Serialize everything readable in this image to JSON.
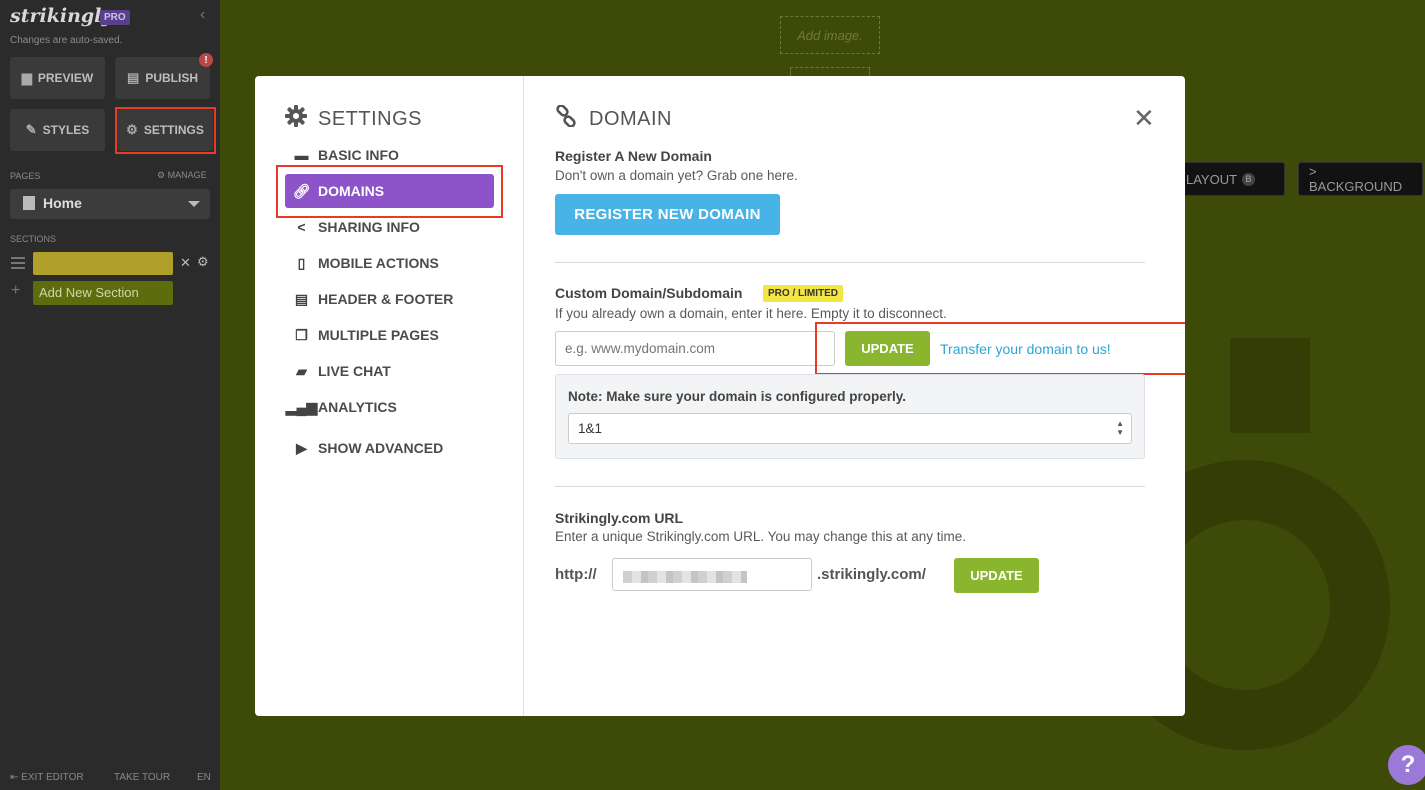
{
  "sidebar": {
    "brand": "strikingly",
    "pro_badge": "PRO",
    "autosave": "Changes are auto-saved.",
    "buttons": {
      "preview": "PREVIEW",
      "publish": "PUBLISH",
      "publish_alert": "!",
      "styles": "STYLES",
      "settings": "SETTINGS"
    },
    "pages_label": "PAGES",
    "manage_label": "MANAGE",
    "current_page": "Home",
    "sections_label": "SECTIONS",
    "add_section": "Add New Section",
    "footer": {
      "exit": "EXIT EDITOR",
      "tour": "TAKE TOUR",
      "lang": "EN"
    }
  },
  "canvas": {
    "add_image": "Add image.",
    "layout_btn": "LAYOUT",
    "layout_badge": "B",
    "background_btn": "> BACKGROUND",
    "help": "?"
  },
  "modal": {
    "nav_title": "SETTINGS",
    "nav_items": [
      {
        "label": "BASIC INFO",
        "icon": "briefcase-icon"
      },
      {
        "label": "DOMAINS",
        "icon": "link-icon"
      },
      {
        "label": "SHARING INFO",
        "icon": "share-icon"
      },
      {
        "label": "MOBILE ACTIONS",
        "icon": "mobile-icon"
      },
      {
        "label": "HEADER & FOOTER",
        "icon": "header-footer-icon"
      },
      {
        "label": "MULTIPLE PAGES",
        "icon": "pages-icon"
      },
      {
        "label": "LIVE CHAT",
        "icon": "chat-icon"
      },
      {
        "label": "ANALYTICS",
        "icon": "analytics-icon"
      },
      {
        "label": "SHOW ADVANCED",
        "icon": "advanced-icon"
      }
    ],
    "active_nav": "DOMAINS",
    "title": "DOMAIN",
    "register": {
      "heading": "Register A New Domain",
      "text": "Don't own a domain yet? Grab one here.",
      "button": "REGISTER NEW DOMAIN"
    },
    "custom": {
      "heading": "Custom Domain/Subdomain",
      "tag": "PRO / LIMITED",
      "text": "If you already own a domain, enter it here. Empty it to disconnect.",
      "placeholder": "e.g. www.mydomain.com",
      "update": "UPDATE",
      "transfer": "Transfer your domain to us!",
      "note": "Note: Make sure your domain is configured properly.",
      "provider": "1&1"
    },
    "strikingly_url": {
      "heading": "Strikingly.com URL",
      "text": "Enter a unique Strikingly.com URL. You may change this at any time.",
      "prefix": "http://",
      "suffix": ".strikingly.com/",
      "update": "UPDATE"
    }
  },
  "colors": {
    "accent_purple": "#8d54c9",
    "register_blue": "#48b3e6",
    "update_green": "#8ab52f",
    "highlight_red": "#e63b24",
    "link_blue": "#2ba5d6"
  }
}
